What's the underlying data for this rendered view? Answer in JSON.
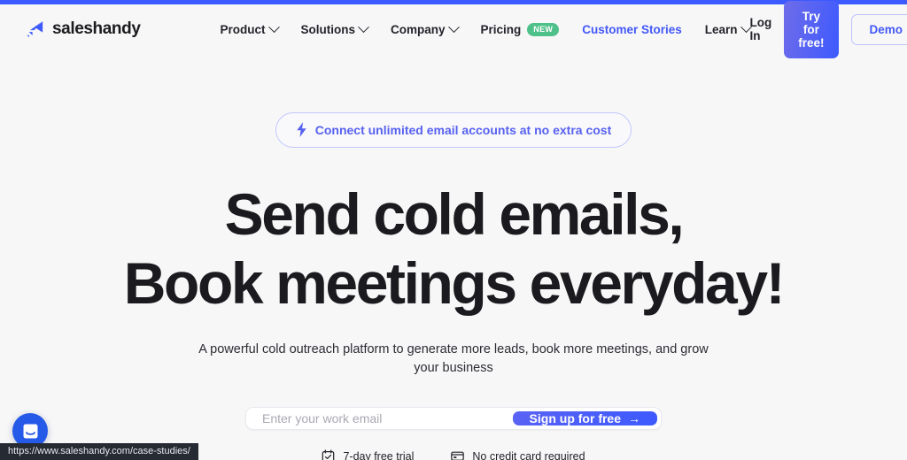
{
  "browser": {
    "accent_color": "#3d5afe",
    "status_url": "https://www.saleshandy.com/case-studies/"
  },
  "header": {
    "brand": {
      "name": "saleshandy",
      "logo_icon": "saleshandy-arrow-logo",
      "logo_color": "#3d5afe"
    },
    "nav": [
      {
        "label": "Product",
        "has_dropdown": true,
        "accent": false,
        "badge": ""
      },
      {
        "label": "Solutions",
        "has_dropdown": true,
        "accent": false,
        "badge": ""
      },
      {
        "label": "Company",
        "has_dropdown": true,
        "accent": false,
        "badge": ""
      },
      {
        "label": "Pricing",
        "has_dropdown": false,
        "accent": false,
        "badge": "NEW"
      },
      {
        "label": "Customer Stories",
        "has_dropdown": false,
        "accent": true,
        "badge": ""
      },
      {
        "label": "Learn",
        "has_dropdown": true,
        "accent": false,
        "badge": ""
      }
    ],
    "actions": {
      "login_label": "Log In",
      "try_label": "Try for free!",
      "demo_label": "Demo"
    },
    "badge_color": "#4ec08a",
    "accent_color": "#4358f6"
  },
  "hero": {
    "announcement": {
      "icon": "lightning-bolt-icon",
      "text": "Connect unlimited email accounts at no extra cost",
      "text_color": "#5761ef",
      "border_color": "#c3c8fb"
    },
    "title_line_1": "Send cold emails,",
    "title_line_2": "Book meetings everyday!",
    "subtitle": "A powerful cold outreach platform to generate more leads, book more meetings, and grow your business",
    "form": {
      "email_placeholder": "Enter your work email",
      "email_value": "",
      "submit_label": "Sign up for free",
      "submit_arrow": "→"
    },
    "trust": [
      {
        "icon": "calendar-check-icon",
        "label": "7-day free trial"
      },
      {
        "icon": "credit-card-icon",
        "label": "No credit card required"
      }
    ]
  },
  "chat": {
    "icon": "chat-message-icon",
    "color": "#2559e8"
  }
}
